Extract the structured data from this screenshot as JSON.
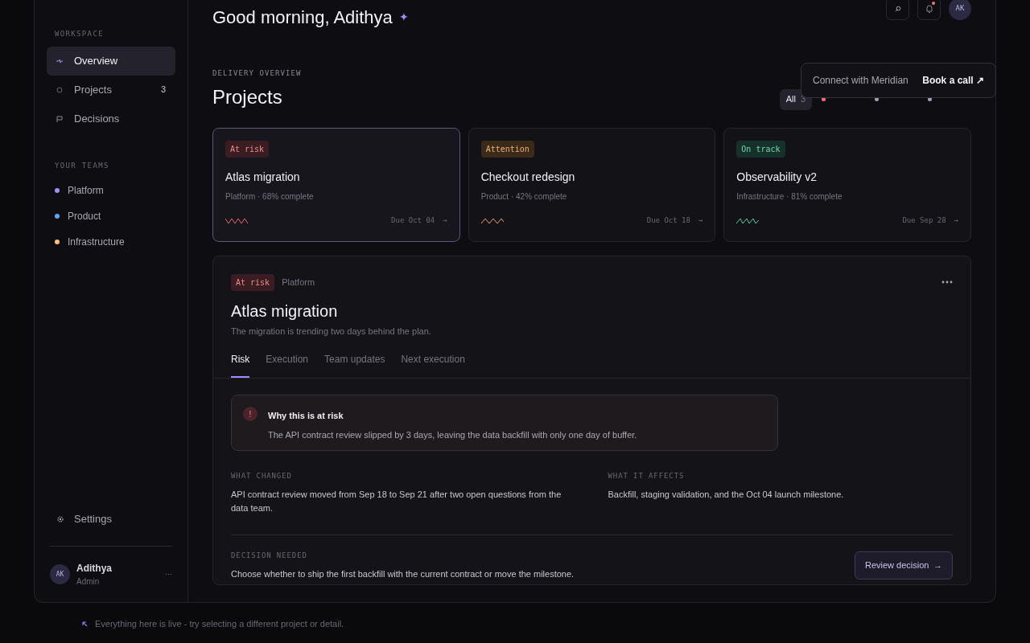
{
  "sidebar": {
    "sections": [
      {
        "title": "WORKSPACE",
        "items": [
          {
            "label": "Overview",
            "kind": "pulse",
            "selected": true
          },
          {
            "label": "Projects",
            "kind": "circle",
            "count": "3",
            "selected": false
          },
          {
            "label": "Decisions",
            "kind": "flag",
            "selected": false
          }
        ]
      }
    ],
    "teams_title": "YOUR TEAMS",
    "teams": [
      {
        "label": "Platform",
        "color": "#a78bfa"
      },
      {
        "label": "Product",
        "color": "#60a5fa"
      },
      {
        "label": "Infrastructure",
        "color": "#fbbf77"
      }
    ],
    "settings": "Settings",
    "user": {
      "initials": "AK",
      "name": "Adithya",
      "role": "Admin",
      "menu": "···"
    }
  },
  "header": {
    "greeting": "Good morning, Adithya",
    "sparkle": "✦",
    "avatar": "AK",
    "notification": true
  },
  "section": {
    "eyebrow": "DELIVERY OVERVIEW",
    "title": "Projects"
  },
  "filters": [
    {
      "kind": "all",
      "label": "All",
      "count": "3",
      "selected": true
    },
    {
      "kind": "dot",
      "color": "#f87171"
    },
    {
      "kind": "dot",
      "color": "#9ca3af"
    },
    {
      "kind": "dot",
      "color": "#9ca3af"
    }
  ],
  "popover": {
    "text": "Connect with Meridian",
    "action": "Book a call ↗"
  },
  "projects": [
    {
      "kind": "at_risk",
      "badge": "At risk",
      "name": "Atlas migration",
      "meta": "Platform · 68% complete",
      "due": "Due Oct 04",
      "arrow": "→",
      "selected": true
    },
    {
      "kind": "attention",
      "badge": "Attention",
      "name": "Checkout redesign",
      "meta": "Product · 42% complete",
      "due": "Due Oct 18",
      "arrow": "→",
      "selected": false
    },
    {
      "kind": "on_track",
      "badge": "On track",
      "name": "Observability v2",
      "meta": "Infrastructure · 81% complete",
      "due": "Due Sep 28",
      "arrow": "→",
      "selected": false
    }
  ],
  "detail": {
    "kind": "at_risk",
    "badge": "At risk",
    "team": "Platform",
    "title": "Atlas migration",
    "subtitle": "The migration is trending two days behind the plan.",
    "tabs": [
      {
        "label": "Risk",
        "selected": true
      },
      {
        "label": "Execution",
        "selected": false
      },
      {
        "label": "Team updates",
        "selected": false
      },
      {
        "label": "Next execution",
        "selected": false
      }
    ],
    "alert": {
      "icon": "!",
      "title": "Why this is at risk",
      "text": "The API contract review slipped by 3 days, leaving the data backfill with only one day of buffer."
    },
    "columns": [
      {
        "label": "WHAT CHANGED",
        "text": "API contract review moved from Sep 18 to Sep 21 after two open questions from the data team."
      },
      {
        "label": "WHAT IT AFFECTS",
        "text": "Backfill, staging validation, and the Oct 04 launch milestone."
      }
    ],
    "decision": {
      "label": "DECISION NEEDED",
      "text": "Choose whether to ship the first backfill with the current contract or move the milestone.",
      "button": "Review decision",
      "arrow": "→"
    }
  },
  "footer_hint": "Everything here is live - try selecting a different project or detail."
}
